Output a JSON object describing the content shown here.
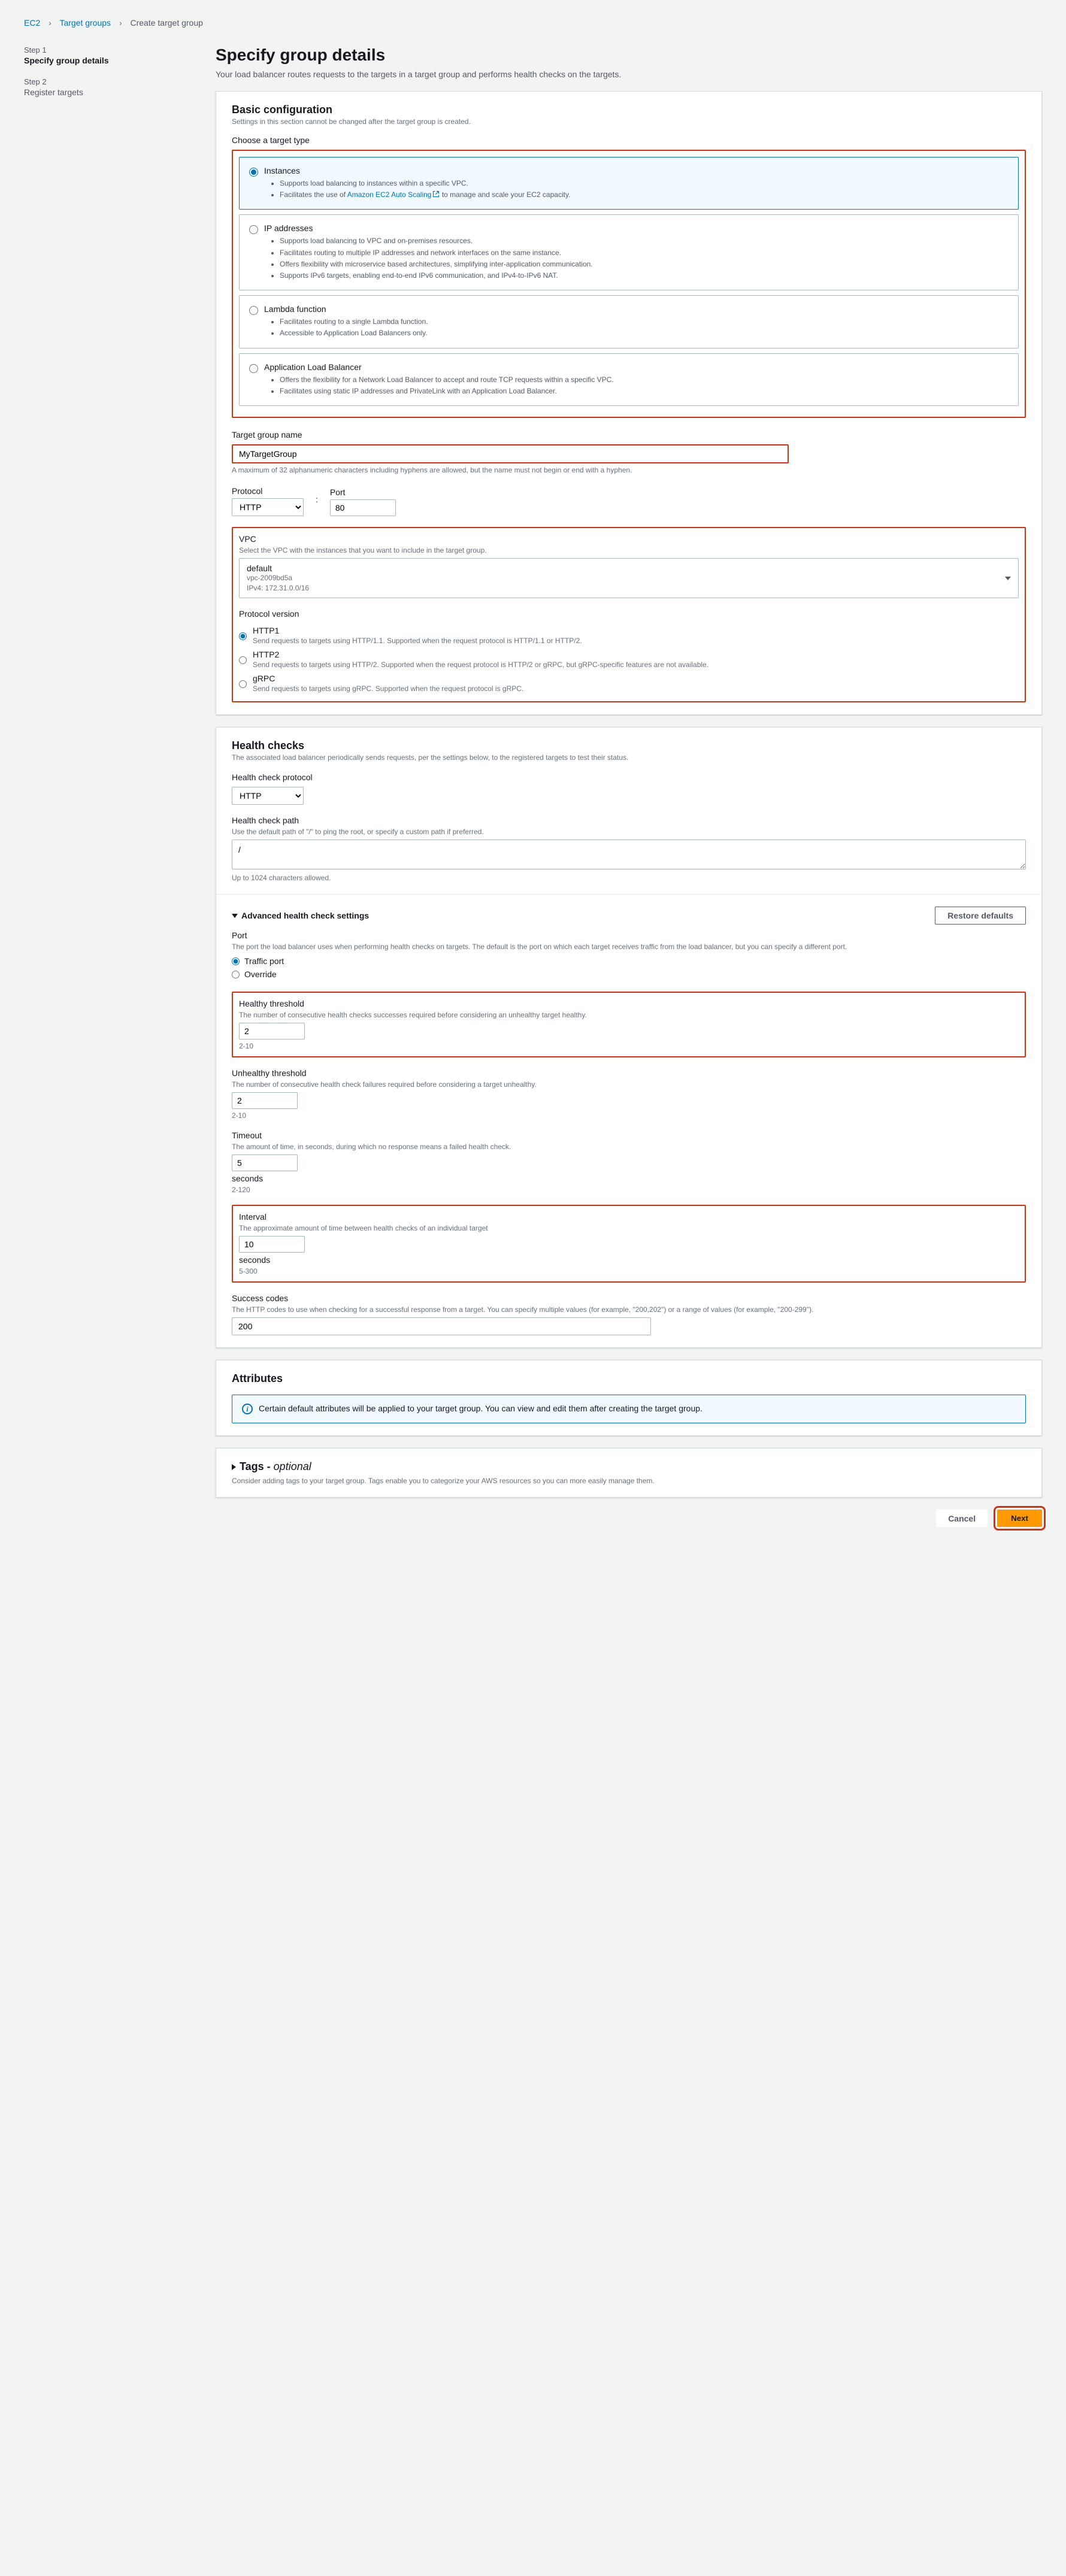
{
  "breadcrumb": {
    "l1": "EC2",
    "l2": "Target groups",
    "l3": "Create target group"
  },
  "steps": {
    "s1num": "Step 1",
    "s1title": "Specify group details",
    "s2num": "Step 2",
    "s2title": "Register targets"
  },
  "page": {
    "title": "Specify group details",
    "subtitle": "Your load balancer routes requests to the targets in a target group and performs health checks on the targets."
  },
  "basic": {
    "heading": "Basic configuration",
    "desc": "Settings in this section cannot be changed after the target group is created.",
    "choose_label": "Choose a target type",
    "types": {
      "instances": {
        "title": "Instances",
        "b1": "Supports load balancing to instances within a specific VPC.",
        "b2a": "Facilitates the use of ",
        "b2link": "Amazon EC2 Auto Scaling",
        "b2b": " to manage and scale your EC2 capacity."
      },
      "ip": {
        "title": "IP addresses",
        "b1": "Supports load balancing to VPC and on-premises resources.",
        "b2": "Facilitates routing to multiple IP addresses and network interfaces on the same instance.",
        "b3": "Offers flexibility with microservice based architectures, simplifying inter-application communication.",
        "b4": "Supports IPv6 targets, enabling end-to-end IPv6 communication, and IPv4-to-IPv6 NAT."
      },
      "lambda": {
        "title": "Lambda function",
        "b1": "Facilitates routing to a single Lambda function.",
        "b2": "Accessible to Application Load Balancers only."
      },
      "alb": {
        "title": "Application Load Balancer",
        "b1": "Offers the flexibility for a Network Load Balancer to accept and route TCP requests within a specific VPC.",
        "b2": "Facilitates using static IP addresses and PrivateLink with an Application Load Balancer."
      }
    },
    "tgname_label": "Target group name",
    "tgname_value": "MyTargetGroup",
    "tgname_hint": "A maximum of 32 alphanumeric characters including hyphens are allowed, but the name must not begin or end with a hyphen.",
    "protocol_label": "Protocol",
    "protocol_value": "HTTP",
    "port_label": "Port",
    "port_value": "80",
    "vpc_label": "VPC",
    "vpc_desc": "Select the VPC with the instances that you want to include in the target group.",
    "vpc_name": "default",
    "vpc_id": "vpc-2009bd5a",
    "vpc_cidr": "IPv4: 172.31.0.0/16",
    "pv_label": "Protocol version",
    "pv": {
      "http1": {
        "t": "HTTP1",
        "d": "Send requests to targets using HTTP/1.1. Supported when the request protocol is HTTP/1.1 or HTTP/2."
      },
      "http2": {
        "t": "HTTP2",
        "d": "Send requests to targets using HTTP/2. Supported when the request protocol is HTTP/2 or gRPC, but gRPC-specific features are not available."
      },
      "grpc": {
        "t": "gRPC",
        "d": "Send requests to targets using gRPC. Supported when the request protocol is gRPC."
      }
    }
  },
  "health": {
    "heading": "Health checks",
    "desc": "The associated load balancer periodically sends requests, per the settings below, to the registered targets to test their status.",
    "proto_label": "Health check protocol",
    "proto_value": "HTTP",
    "path_label": "Health check path",
    "path_desc": "Use the default path of \"/\" to ping the root, or specify a custom path if preferred.",
    "path_value": "/",
    "path_hint": "Up to 1024 characters allowed.",
    "adv_label": "Advanced health check settings",
    "restore": "Restore defaults",
    "port_label": "Port",
    "port_desc": "The port the load balancer uses when performing health checks on targets. The default is the port on which each target receives traffic from the load balancer, but you can specify a different port.",
    "port_traffic": "Traffic port",
    "port_override": "Override",
    "healthy_label": "Healthy threshold",
    "healthy_desc": "The number of consecutive health checks successes required before considering an unhealthy target healthy.",
    "healthy_value": "2",
    "healthy_range": "2-10",
    "unhealthy_label": "Unhealthy threshold",
    "unhealthy_desc": "The number of consecutive health check failures required before considering a target unhealthy.",
    "unhealthy_value": "2",
    "unhealthy_range": "2-10",
    "timeout_label": "Timeout",
    "timeout_desc": "The amount of time, in seconds, during which no response means a failed health check.",
    "timeout_value": "5",
    "timeout_unit": "seconds",
    "timeout_range": "2-120",
    "interval_label": "Interval",
    "interval_desc": "The approximate amount of time between health checks of an individual target",
    "interval_value": "10",
    "interval_unit": "seconds",
    "interval_range": "5-300",
    "success_label": "Success codes",
    "success_desc": "The HTTP codes to use when checking for a successful response from a target. You can specify multiple values (for example, \"200,202\") or a range of values (for example, \"200-299\").",
    "success_value": "200"
  },
  "attributes": {
    "heading": "Attributes",
    "info": "Certain default attributes will be applied to your target group. You can view and edit them after creating the target group."
  },
  "tags": {
    "heading": "Tags - ",
    "optional": "optional",
    "desc": "Consider adding tags to your target group. Tags enable you to categorize your AWS resources so you can more easily manage them."
  },
  "footer": {
    "cancel": "Cancel",
    "next": "Next"
  }
}
